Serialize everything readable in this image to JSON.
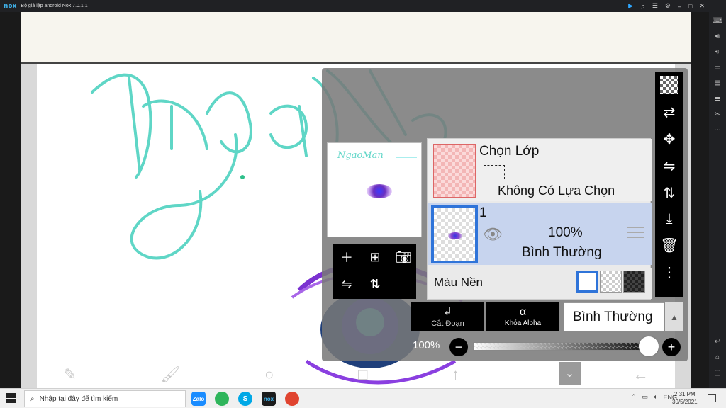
{
  "window": {
    "logo": "nox",
    "title": "Bộ giả lập android Nox 7.0.1.1",
    "title_icons": [
      "play-icon",
      "headphones-icon",
      "menu-icon",
      "gear-icon",
      "minimize-icon",
      "restore-icon",
      "close-icon"
    ]
  },
  "sidebar": {
    "icons": [
      "keyboard-icon",
      "volume-up-icon",
      "volume-down-icon",
      "screen-icon",
      "apk-icon",
      "stack-icon",
      "scissors-icon",
      "more-icon"
    ],
    "nav_icons": [
      "back-icon",
      "home-icon",
      "recent-apps-icon"
    ]
  },
  "artwork": {
    "text": "NgaoMan",
    "stroke_color": "#5fd6c6",
    "eye_color": "#3a2cc9"
  },
  "layer_panel": {
    "selection_layer": {
      "name": "Chọn Lớp",
      "description": "Không Có Lựa Chọn"
    },
    "layers": [
      {
        "number": "1",
        "opacity": "100%",
        "blend_mode": "Bình Thường"
      }
    ],
    "background": {
      "label": "Màu Nền",
      "swatches": [
        "white",
        "transparent",
        "dark"
      ]
    },
    "thumbnail_tools": [
      "add-layer-icon",
      "add-copy-layer-icon",
      "camera-icon",
      "flip-horizontal-icon",
      "flip-vertical-icon"
    ],
    "side_tools": [
      "transparency-icon",
      "transfer-icon",
      "move-icon",
      "flip-horizontal-icon",
      "flip-vertical-icon",
      "merge-down-icon",
      "trash-icon",
      "more-vertical-icon"
    ],
    "clipping": {
      "label": "Cắt Đoạn"
    },
    "alpha_lock": {
      "label": "Khóa Alpha",
      "symbol": "α"
    },
    "blend_select": {
      "value": "Bình Thường"
    },
    "opacity": {
      "label": "100%",
      "value": 1.0
    }
  },
  "bottom_toolbar": {
    "icons": [
      "eraser-icon",
      "brush-icon",
      "circle-icon",
      "square-icon",
      "arrow-up-icon",
      "collapse-icon",
      "arrow-left-icon"
    ]
  },
  "taskbar": {
    "search_placeholder": "Nhập tại đây để tìm kiếm",
    "apps": [
      "Zalo",
      "Photos",
      "Skype",
      "Nox",
      "Chrome"
    ],
    "language": "ENG",
    "time": "2:31 PM",
    "date": "30/5/2021"
  }
}
